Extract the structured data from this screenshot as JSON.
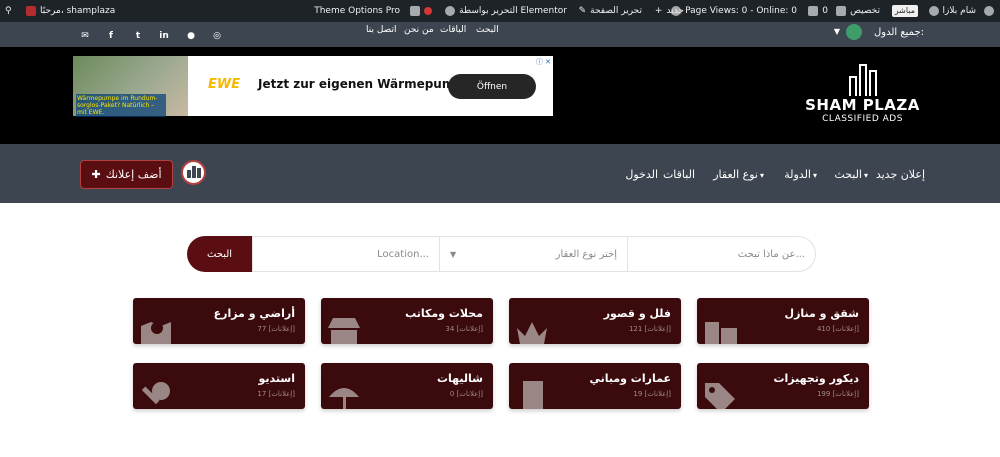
{
  "admin_bar": {
    "site_name": "شام بلازا",
    "live_badge": "مباشر",
    "customize": "تخصيص",
    "comments_count": "0",
    "page_views": "Page Views: 0 - Online: 0",
    "new": "جديد",
    "edit_page": "تحرير الصفحة",
    "elementor": "التحرير بواسطة Elementor",
    "theme_options": "Theme Options Pro",
    "greeting": "مرحبًا، shamplaza"
  },
  "top_bar": {
    "country_label": "جميع الدول:",
    "links": [
      "البحث",
      "الباقات",
      "من نحن",
      "اتصل بنا"
    ]
  },
  "ad": {
    "photo_text": "Wärmepumpe im Rundum-sorglos-Paket? Natürlich – mit EWE.",
    "brand": "EWE",
    "slogan": "Jetzt zur eigenen Wärmepumpe.",
    "cta": "Öffnen"
  },
  "logo": {
    "name": "SHAM PLAZA",
    "tagline": "CLASSIFIED ADS"
  },
  "nav": {
    "items": [
      "إعلان جديد",
      "البحث",
      "الدولة",
      "نوع العقار",
      "الباقات",
      "الدخول"
    ],
    "add_listing": "أضف إعلانك"
  },
  "search": {
    "keyword_placeholder": "عن ماذا تبحث...",
    "type_placeholder": "إختر نوع العقار",
    "location_placeholder": "Location...",
    "button": "البحث"
  },
  "categories": [
    {
      "title": "شقق و منازل",
      "count": "410 [إعلانات]",
      "icon": "building-icon"
    },
    {
      "title": "فلل و قصور",
      "count": "121 [إعلانات]",
      "icon": "crown-icon"
    },
    {
      "title": "محلات ومكاتب",
      "count": "34 [إعلانات]",
      "icon": "store-icon"
    },
    {
      "title": "أراضي و مزارع",
      "count": "77 [إعلانات]",
      "icon": "map-pin-icon"
    },
    {
      "title": "ديكور وتجهيزات",
      "count": "199 [إعلانات]",
      "icon": "tags-icon"
    },
    {
      "title": "عمارات ومباني",
      "count": "19 [إعلانات]",
      "icon": "tower-icon"
    },
    {
      "title": "شاليهات",
      "count": "0 [إعلانات]",
      "icon": "umbrella-icon"
    },
    {
      "title": "استديو",
      "count": "17 [إعلانات]",
      "icon": "key-icon"
    }
  ],
  "colors": {
    "dark": "#3d4650",
    "brand": "#5a0e12",
    "card": "#3a0a0d"
  }
}
